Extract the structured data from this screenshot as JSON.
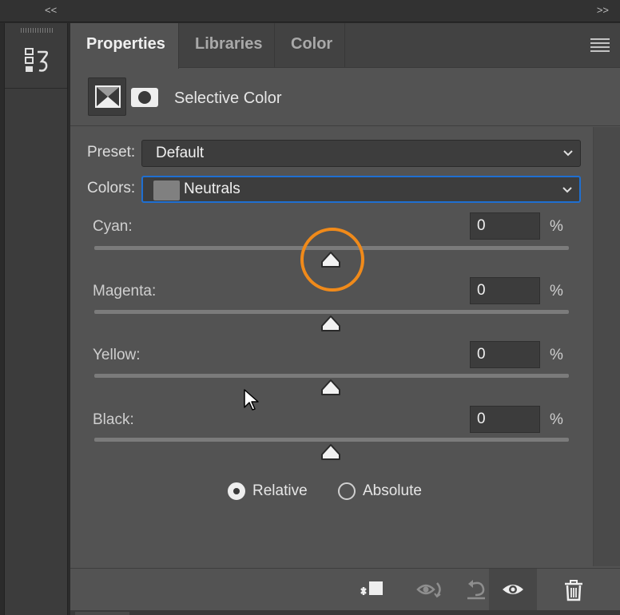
{
  "topbar": {
    "collapse_left": "<<",
    "collapse_right": ">>"
  },
  "tabs": [
    {
      "label": "Properties",
      "active": true
    },
    {
      "label": "Libraries",
      "active": false
    },
    {
      "label": "Color",
      "active": false
    }
  ],
  "panel_menu_icon": "hamburger-menu-icon",
  "adjustment": {
    "title": "Selective Color",
    "icon": "selective-color-adjustment-icon",
    "mask_icon": "layer-mask-icon"
  },
  "preset": {
    "label": "Preset:",
    "value": "Default"
  },
  "colors": {
    "label": "Colors:",
    "value": "Neutrals",
    "swatch_color": "#808080"
  },
  "sliders": [
    {
      "label": "Cyan:",
      "value": "0",
      "unit": "%"
    },
    {
      "label": "Magenta:",
      "value": "0",
      "unit": "%"
    },
    {
      "label": "Yellow:",
      "value": "0",
      "unit": "%"
    },
    {
      "label": "Black:",
      "value": "0",
      "unit": "%"
    }
  ],
  "method": {
    "options": [
      {
        "label": "Relative",
        "selected": true
      },
      {
        "label": "Absolute",
        "selected": false
      }
    ]
  },
  "footer_icons": [
    "clip-to-layer-icon",
    "view-previous-state-icon",
    "reset-adjustment-icon",
    "visibility-eye-icon",
    "delete-trash-icon"
  ],
  "accent": {
    "focus": "#1f6fd1",
    "highlight_ring": "#f08a1a"
  }
}
